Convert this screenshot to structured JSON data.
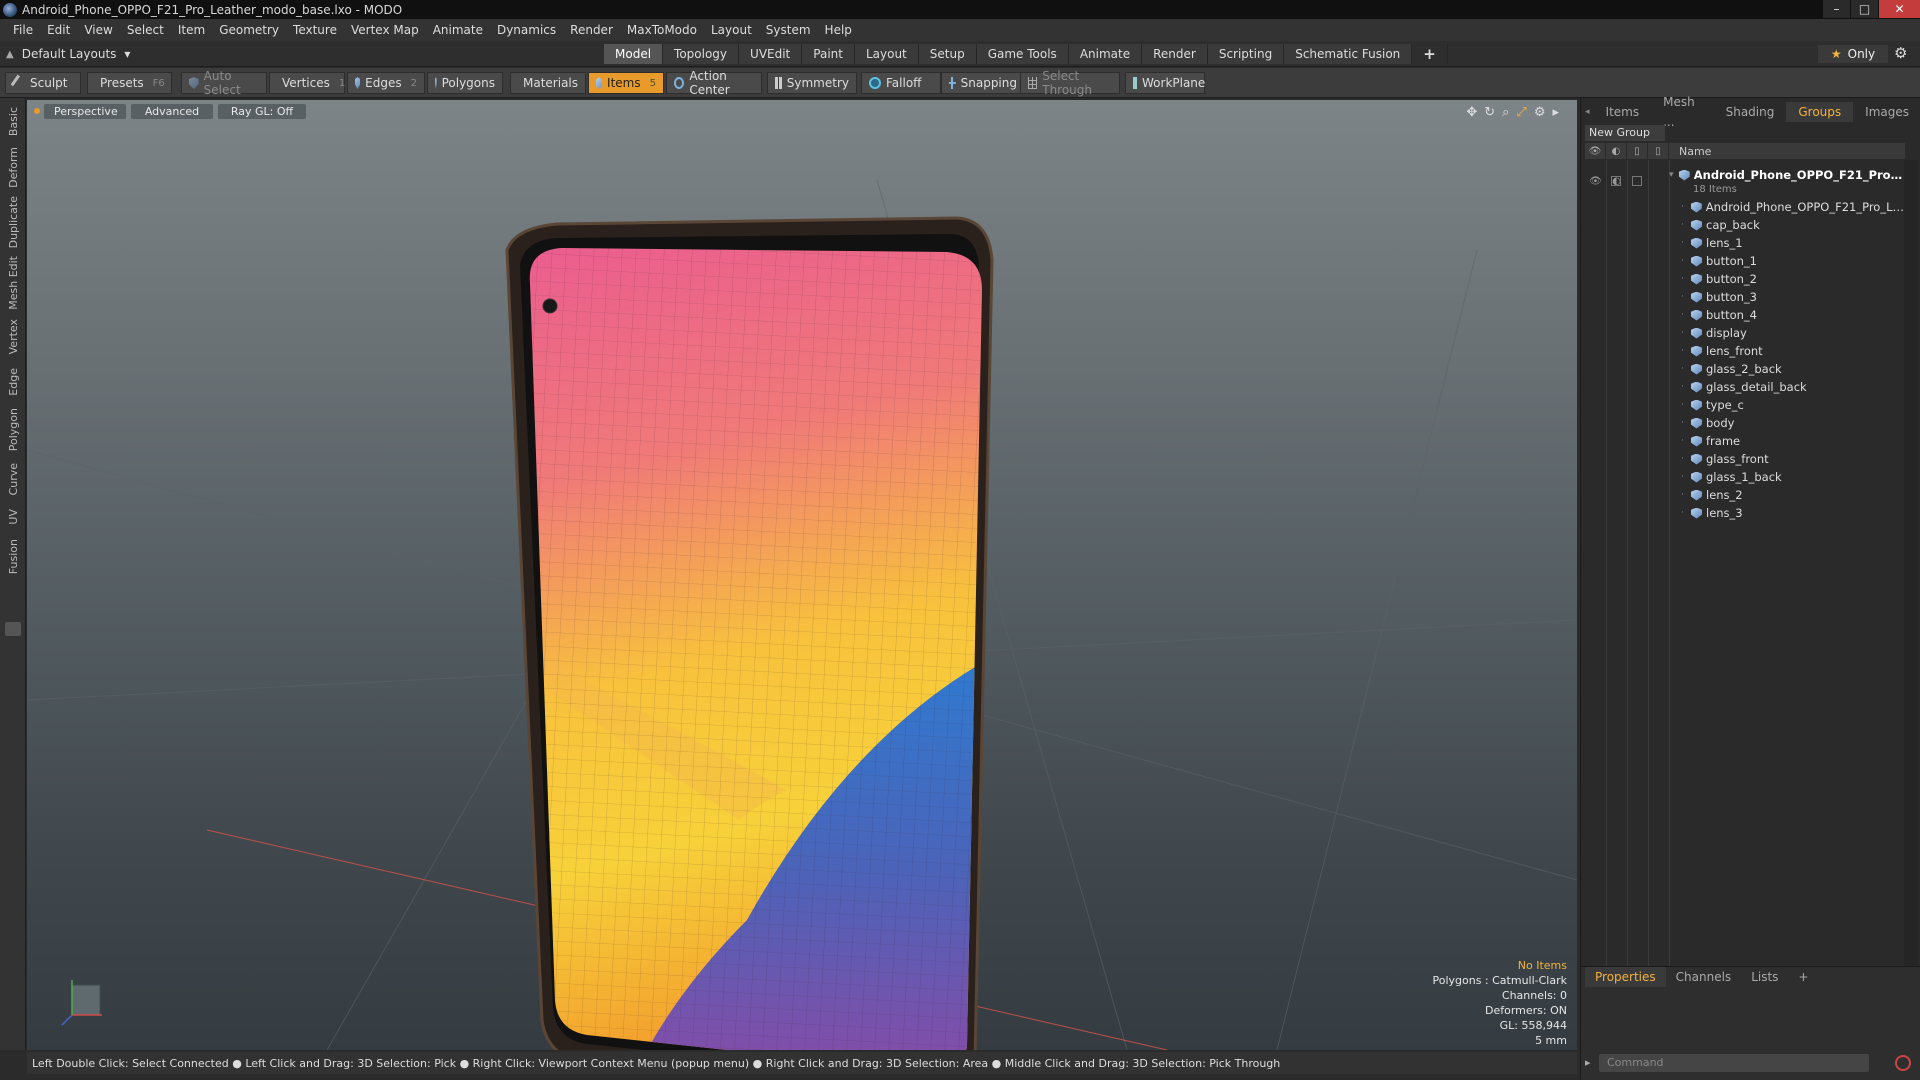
{
  "window": {
    "title": "Android_Phone_OPPO_F21_Pro_Leather_modo_base.lxo - MODO",
    "buttons": [
      "–",
      "□",
      "✕"
    ]
  },
  "menu": [
    "File",
    "Edit",
    "View",
    "Select",
    "Item",
    "Geometry",
    "Texture",
    "Vertex Map",
    "Animate",
    "Dynamics",
    "Render",
    "MaxToModo",
    "Layout",
    "System",
    "Help"
  ],
  "layout": {
    "selector": "Default Layouts",
    "tabs": [
      "Model",
      "Topology",
      "UVEdit",
      "Paint",
      "Layout",
      "Setup",
      "Game Tools",
      "Animate",
      "Render",
      "Scripting",
      "Schematic Fusion"
    ],
    "active_tab": "Model",
    "only_label": "Only"
  },
  "toolbar": {
    "sculpt": "Sculpt",
    "presets": "Presets",
    "presets_key": "F6",
    "auto_select": "Auto Select",
    "vertices": "Vertices",
    "vertices_count": "1",
    "edges": "Edges",
    "edges_count": "2",
    "polygons": "Polygons",
    "materials": "Materials",
    "items": "Items",
    "items_count": "5",
    "action_center": "Action Center",
    "symmetry": "Symmetry",
    "falloff": "Falloff",
    "snapping": "Snapping",
    "select_through": "Select Through",
    "workplane": "WorkPlane"
  },
  "left_tabs": [
    "Basic",
    "Deform",
    "Duplicate",
    "Mesh Edit",
    "Vertex",
    "Edge",
    "Polygon",
    "Curve",
    "UV",
    "Fusion"
  ],
  "viewport": {
    "view": "Perspective",
    "shading": "Advanced",
    "raygl": "Ray GL: Off",
    "info": {
      "no_items": "No Items",
      "polygons": "Polygons : Catmull-Clark",
      "channels": "Channels: 0",
      "deformers": "Deformers: ON",
      "gl": "GL: 558,944",
      "scale": "5 mm"
    }
  },
  "statusbar": "Left Double Click: Select Connected ● Left Click and Drag: 3D Selection: Pick ● Right Click: Viewport Context Menu (popup menu) ● Right Click and Drag: 3D Selection: Area ● Middle Click and Drag: 3D Selection: Pick Through",
  "right_panel": {
    "tabs": [
      "Items",
      "Mesh ...",
      "Shading",
      "Groups",
      "Images"
    ],
    "active_tab": "Groups",
    "new_group": "New Group",
    "name_header": "Name",
    "group_name": "Android_Phone_OPPO_F21_Pro ...",
    "group_count": "18 Items",
    "items": [
      "Android_Phone_OPPO_F21_Pro_L ...",
      "cap_back",
      "lens_1",
      "button_1",
      "button_2",
      "button_3",
      "button_4",
      "display",
      "lens_front",
      "glass_2_back",
      "glass_detail_back",
      "type_c",
      "body",
      "frame",
      "glass_front",
      "glass_1_back",
      "lens_2",
      "lens_3"
    ],
    "bottom_tabs": [
      "Properties",
      "Channels",
      "Lists"
    ],
    "bottom_active": "Properties",
    "command_placeholder": "Command"
  },
  "colors": {
    "accent": "#e89a2a",
    "active_tab_text": "#f4b23a"
  }
}
